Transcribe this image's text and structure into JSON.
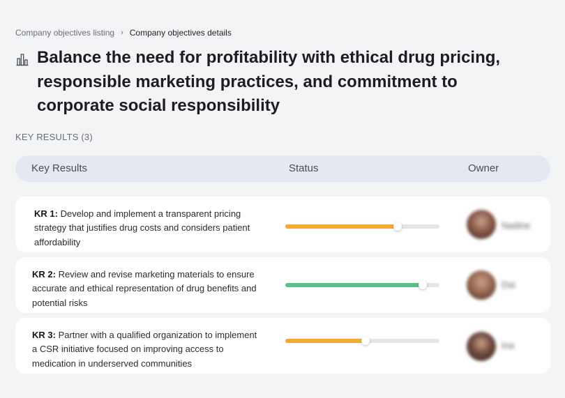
{
  "breadcrumb": {
    "parent": "Company objectives listing",
    "separator": "›",
    "current": "Company objectives details"
  },
  "objective": {
    "icon": "building-chart-icon",
    "title": "Balance the need for profitability with ethical drug pricing, responsible marketing practices, and commitment to corporate social responsibility"
  },
  "key_results_section": {
    "label": "KEY RESULTS (3)"
  },
  "table": {
    "headers": {
      "key_results": "Key Results",
      "status": "Status",
      "owner": "Owner"
    }
  },
  "colors": {
    "progress_orange": "#f6a834",
    "progress_green": "#56c28a",
    "track": "#e4e5e9",
    "header_bg": "#e3e8f1"
  },
  "key_results": [
    {
      "id": "KR 1:",
      "text": "Develop and implement a transparent pricing strategy that justifies drug costs and considers patient affordability",
      "progress": 0.73,
      "color": "#f6a834",
      "owner": "Nadine",
      "avatar_color": "#8a5a4a"
    },
    {
      "id": "KR 2:",
      "text": "Review and revise marketing materials to ensure accurate and ethical representation of drug benefits and potential risks",
      "progress": 0.89,
      "color": "#56c28a",
      "owner": "Dai",
      "avatar_color": "#9a6a55"
    },
    {
      "id": "KR 3:",
      "text": "Partner with a qualified organization to implement a CSR initiative focused on improving access to medication in underserved communities",
      "progress": 0.52,
      "color": "#f6a834",
      "owner": "Ina",
      "avatar_color": "#6e4a3e"
    }
  ]
}
